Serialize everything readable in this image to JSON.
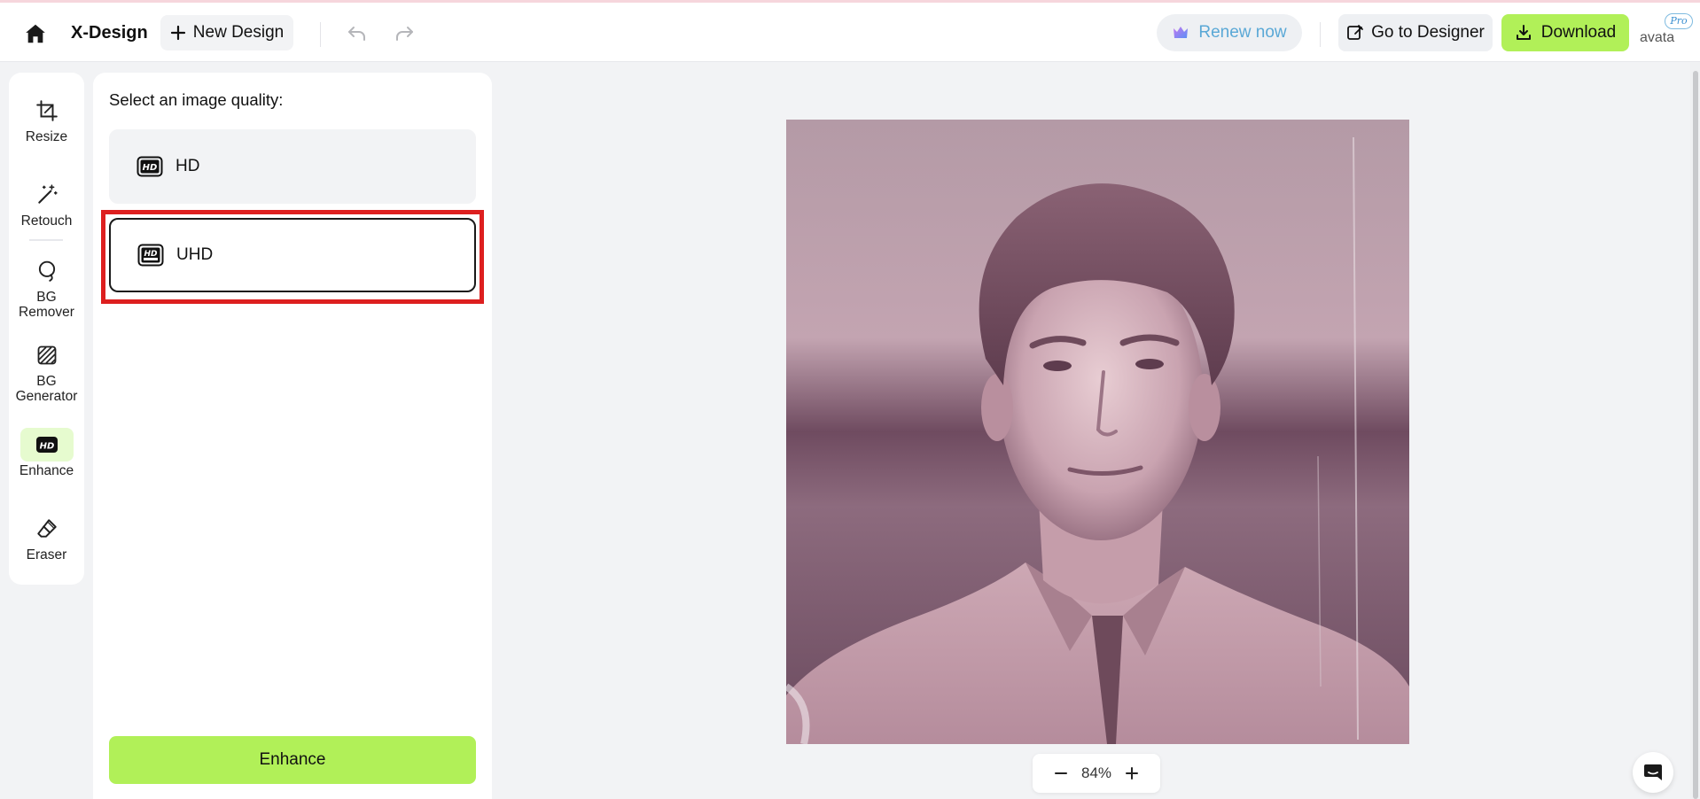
{
  "header": {
    "app_title": "X-Design",
    "new_design_label": "New Design",
    "renew_label": "Renew now",
    "go_to_designer_label": "Go to Designer",
    "download_label": "Download",
    "avatar_alt": "avatar",
    "pro_badge": "Pro"
  },
  "toolbar": {
    "tools": [
      {
        "label": "Resize",
        "icon": "crop-icon",
        "active": false
      },
      {
        "label": "Retouch",
        "icon": "magic-wand-icon",
        "active": false
      },
      {
        "label": "BG Remover",
        "icon": "lasso-icon",
        "active": false
      },
      {
        "label": "BG Generator",
        "icon": "hatched-square-icon",
        "active": false
      },
      {
        "label": "Enhance",
        "icon": "hd-icon",
        "active": true
      },
      {
        "label": "Eraser",
        "icon": "eraser-icon",
        "active": false
      }
    ]
  },
  "panel": {
    "title": "Select an image quality:",
    "options": [
      {
        "label": "HD",
        "icon": "hd-icon",
        "selected": false
      },
      {
        "label": "UHD",
        "icon": "hd-ultra-icon",
        "selected": true
      }
    ],
    "enhance_label": "Enhance"
  },
  "canvas": {
    "zoom": "84%"
  },
  "colors": {
    "accent_green": "#b1f058",
    "highlight_red": "#dd1f1f",
    "renew_text": "#5aa8d6"
  }
}
